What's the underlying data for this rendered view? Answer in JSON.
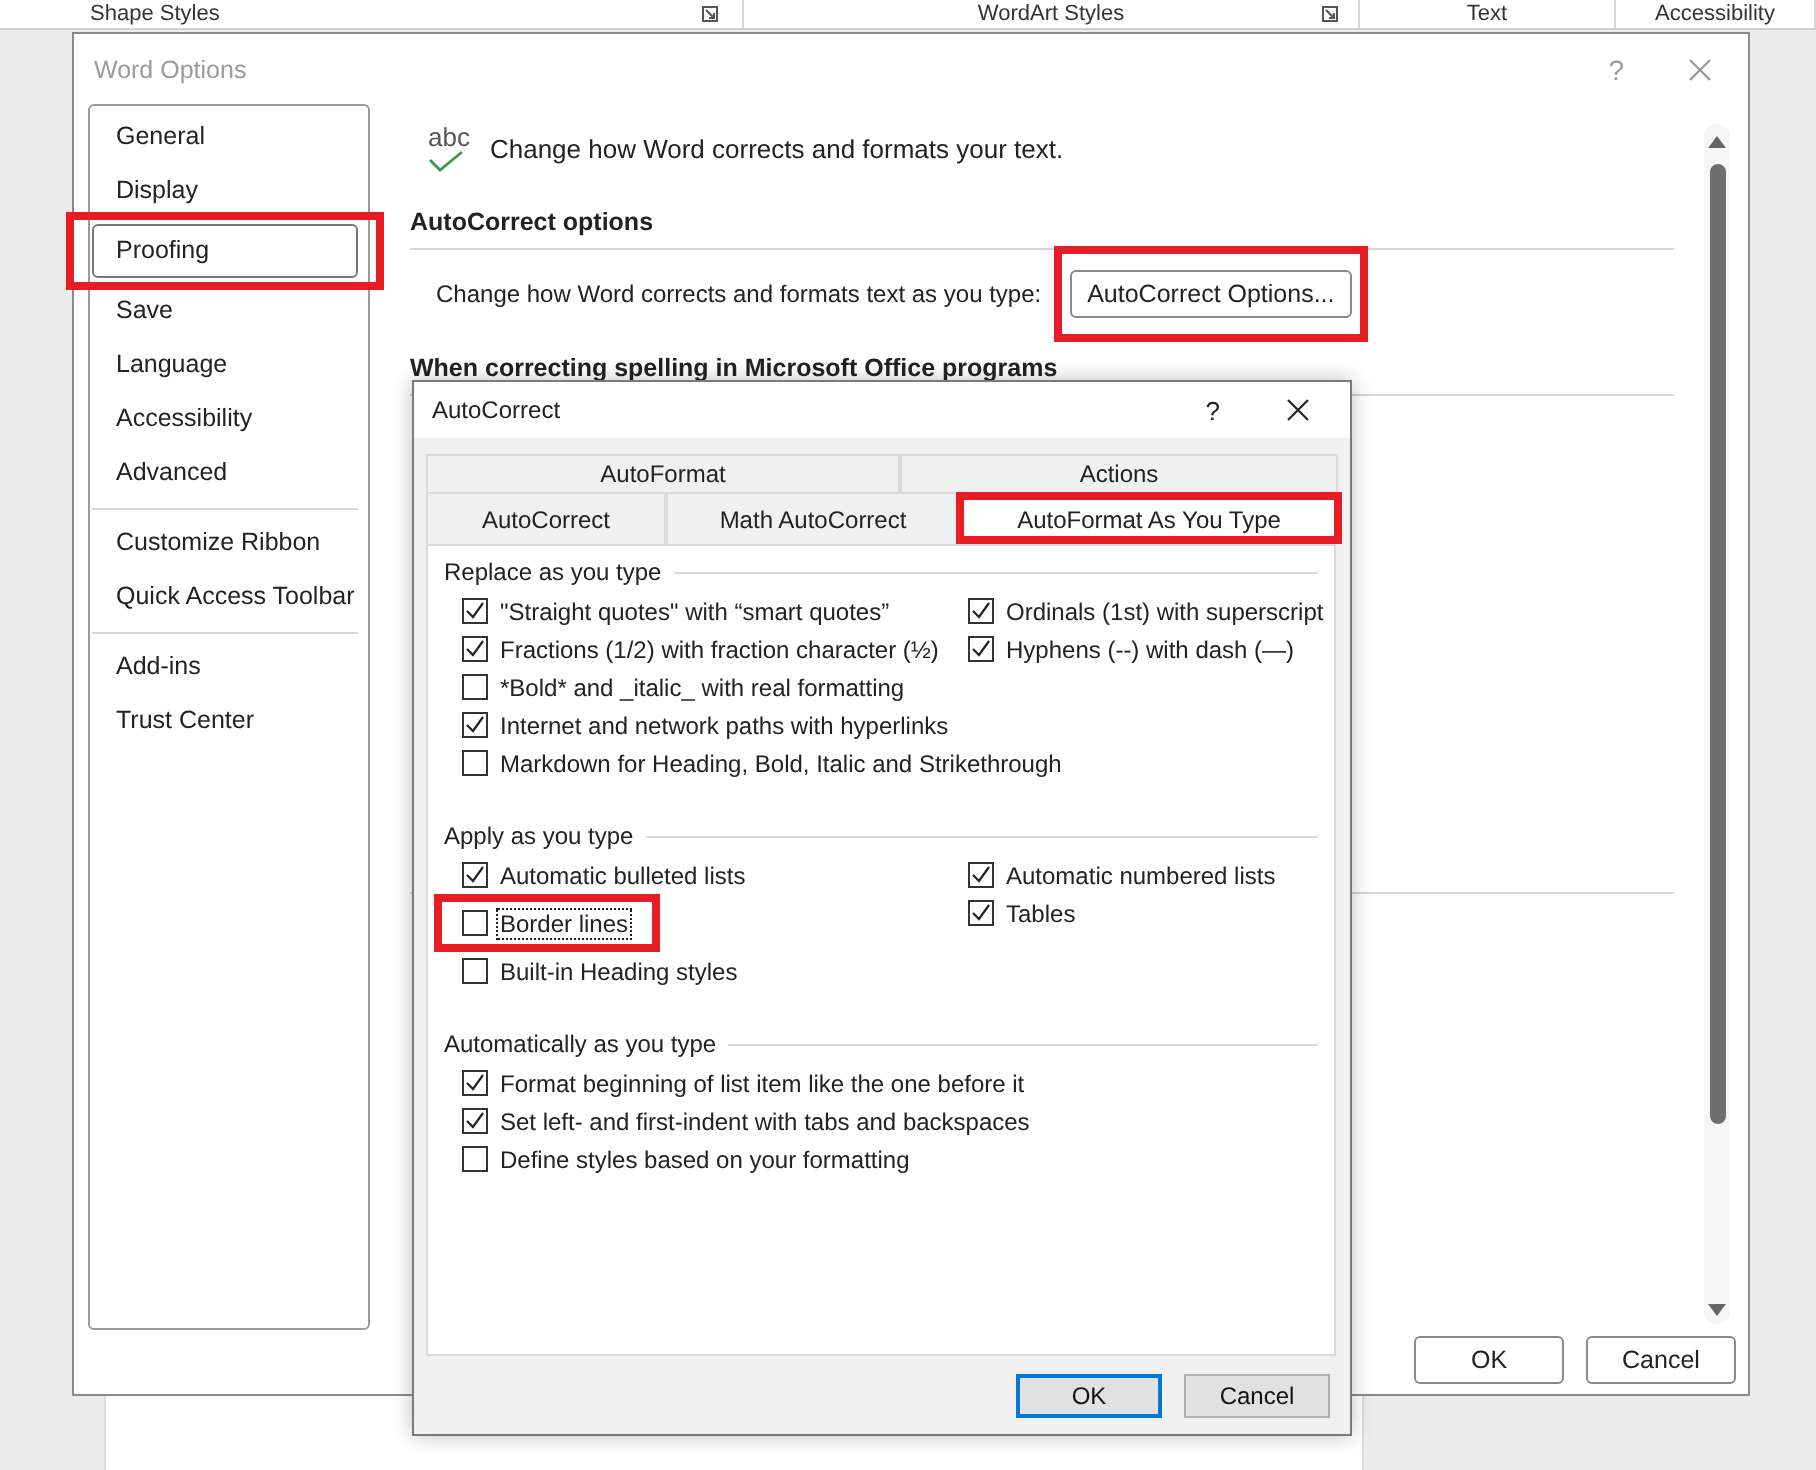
{
  "ribbon": {
    "groups": [
      {
        "label": "Shape Styles",
        "launcher": true
      },
      {
        "label": "WordArt Styles",
        "launcher": true
      },
      {
        "label": "Text",
        "launcher": false
      },
      {
        "label": "Accessibility",
        "launcher": false
      }
    ]
  },
  "word_options": {
    "title": "Word Options",
    "help": "?",
    "sidebar": [
      {
        "items": [
          {
            "label": "General",
            "selected": false,
            "highlighted": false
          },
          {
            "label": "Display",
            "selected": false,
            "highlighted": false
          },
          {
            "label": "Proofing",
            "selected": true,
            "highlighted": true
          },
          {
            "label": "Save",
            "selected": false,
            "highlighted": false
          },
          {
            "label": "Language",
            "selected": false,
            "highlighted": false
          },
          {
            "label": "Accessibility",
            "selected": false,
            "highlighted": false
          },
          {
            "label": "Advanced",
            "selected": false,
            "highlighted": false
          }
        ]
      },
      {
        "items": [
          {
            "label": "Customize Ribbon",
            "selected": false,
            "highlighted": false
          },
          {
            "label": "Quick Access Toolbar",
            "selected": false,
            "highlighted": false
          }
        ]
      },
      {
        "items": [
          {
            "label": "Add-ins",
            "selected": false,
            "highlighted": false
          },
          {
            "label": "Trust Center",
            "selected": false,
            "highlighted": false
          }
        ]
      }
    ],
    "header_icon_text": "abc",
    "header": "Change how Word corrects and formats your text.",
    "sections": [
      {
        "heading": "AutoCorrect options",
        "description": "Change how Word corrects and formats text as you type:",
        "button": {
          "label": "AutoCorrect Options...",
          "highlighted": true
        }
      },
      {
        "heading": "When correcting spelling in Microsoft Office programs"
      }
    ],
    "buttons": [
      "OK",
      "Cancel"
    ]
  },
  "autocorrect_dialog": {
    "title": "AutoCorrect",
    "help": "?",
    "tab_rows": [
      {
        "tabs": [
          {
            "label": "AutoFormat",
            "selected": false,
            "highlighted": false
          },
          {
            "label": "Actions",
            "selected": false,
            "highlighted": false
          }
        ]
      },
      {
        "tabs": [
          {
            "label": "AutoCorrect",
            "selected": false,
            "highlighted": false
          },
          {
            "label": "Math AutoCorrect",
            "selected": false,
            "highlighted": false
          },
          {
            "label": "AutoFormat As You Type",
            "selected": true,
            "highlighted": true
          }
        ]
      }
    ],
    "groups": [
      {
        "heading": "Replace as you type",
        "columns": [
          {
            "options": [
              {
                "label": "\"Straight quotes\" with “smart quotes”",
                "checked": true,
                "focused": false,
                "highlighted": false
              },
              {
                "label": "Fractions (1/2) with fraction character (½)",
                "checked": true,
                "focused": false,
                "highlighted": false
              },
              {
                "label": "*Bold* and _italic_ with real formatting",
                "checked": false,
                "focused": false,
                "highlighted": false
              },
              {
                "label": "Internet and network paths with hyperlinks",
                "checked": true,
                "focused": false,
                "highlighted": false
              },
              {
                "label": "Markdown for Heading, Bold, Italic and Strikethrough",
                "checked": false,
                "focused": false,
                "highlighted": false
              }
            ]
          },
          {
            "options": [
              {
                "label": "Ordinals (1st) with superscript",
                "checked": true,
                "focused": false,
                "highlighted": false
              },
              {
                "label": "Hyphens (--) with dash (—)",
                "checked": true,
                "focused": false,
                "highlighted": false
              }
            ]
          }
        ]
      },
      {
        "heading": "Apply as you type",
        "columns": [
          {
            "options": [
              {
                "label": "Automatic bulleted lists",
                "checked": true,
                "focused": false,
                "highlighted": false
              },
              {
                "label": "Border lines",
                "checked": false,
                "focused": true,
                "highlighted": true
              },
              {
                "label": "Built-in Heading styles",
                "checked": false,
                "focused": false,
                "highlighted": false
              }
            ]
          },
          {
            "options": [
              {
                "label": "Automatic numbered lists",
                "checked": true,
                "focused": false,
                "highlighted": false
              },
              {
                "label": "Tables",
                "checked": true,
                "focused": false,
                "highlighted": false
              }
            ]
          }
        ]
      },
      {
        "heading": "Automatically as you type",
        "columns": [
          {
            "options": [
              {
                "label": "Format beginning of list item like the one before it",
                "checked": true,
                "focused": false,
                "highlighted": false
              },
              {
                "label": "Set left- and first-indent with tabs and backspaces",
                "checked": true,
                "focused": false,
                "highlighted": false
              },
              {
                "label": "Define styles based on your formatting",
                "checked": false,
                "focused": false,
                "highlighted": false
              }
            ]
          }
        ]
      }
    ],
    "buttons": [
      {
        "label": "OK",
        "default": true
      },
      {
        "label": "Cancel",
        "default": false
      }
    ]
  }
}
